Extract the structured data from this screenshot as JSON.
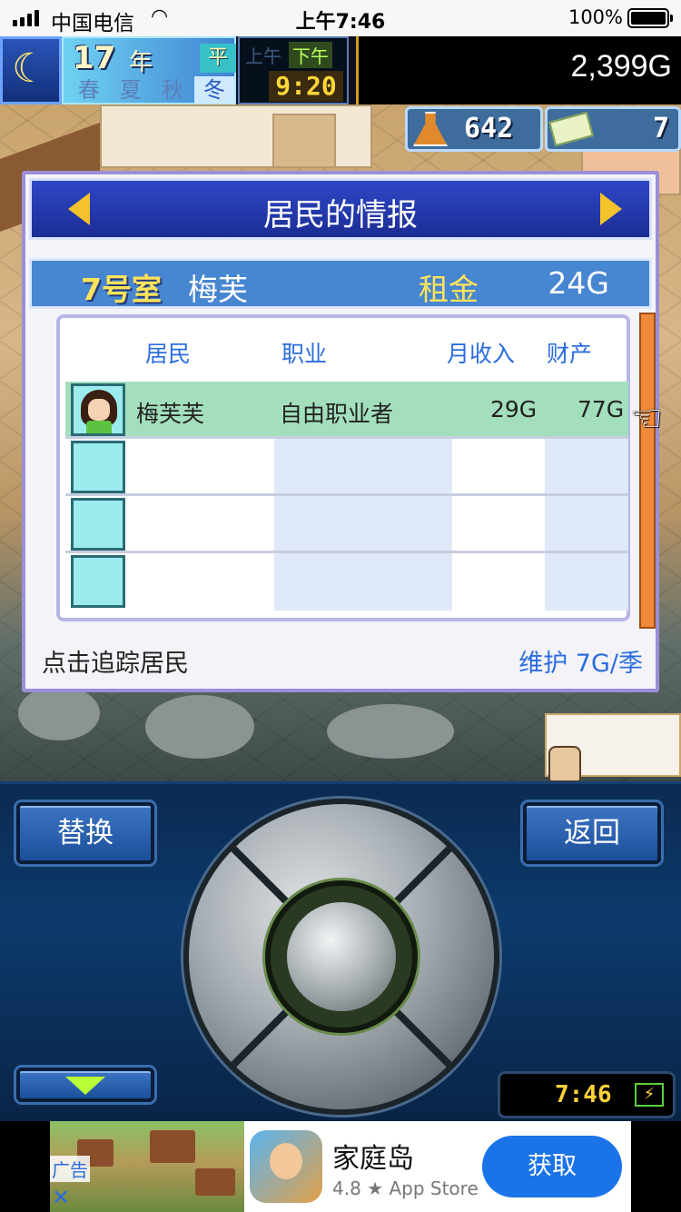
{
  "status_bar": {
    "carrier": "中国电信",
    "time": "上午7:46",
    "battery": "100%"
  },
  "hud": {
    "year": "17",
    "year_unit": "年",
    "difficulty": "平日",
    "seasons": [
      "春",
      "夏",
      "秋",
      "冬"
    ],
    "active_season": "冬",
    "am_label": "上午",
    "pm_label": "下午",
    "clock": "9:20",
    "money": "2,399G",
    "research_points": "642",
    "tickets": "7"
  },
  "panel": {
    "title": "居民的情报",
    "room": "7号室",
    "room_resident": "梅芙",
    "rent_label": "租金",
    "rent_value": "24G",
    "columns": {
      "resident": "居民",
      "job": "职业",
      "income": "月收入",
      "assets": "财产"
    },
    "rows": [
      {
        "name": "梅芙芙",
        "job": "自由职业者",
        "income": "29G",
        "assets": "77G"
      },
      {
        "name": "",
        "job": "",
        "income": "",
        "assets": ""
      },
      {
        "name": "",
        "job": "",
        "income": "",
        "assets": ""
      },
      {
        "name": "",
        "job": "",
        "income": "",
        "assets": ""
      }
    ],
    "hint": "点击追踪居民",
    "maintenance": "维护 7G/季"
  },
  "controls": {
    "replace_label": "替换",
    "back_label": "返回",
    "mini_clock": "7:46"
  },
  "ad": {
    "tag": "广告",
    "close": "✕",
    "title": "家庭岛",
    "subtitle": "4.8 ★ App Store",
    "button": "获取"
  },
  "icons": {
    "moon": "moon-icon",
    "flask": "flask-icon",
    "ticket": "ticket-icon",
    "pointer": "hand-pointer-icon",
    "battery": "lightning-icon"
  },
  "colors": {
    "panel_header": "#2e47c6",
    "room_bar": "#4786d0",
    "selected_row": "#a3dfbd",
    "accent_text": "#2b6de0",
    "ad_button": "#1a73e8"
  }
}
